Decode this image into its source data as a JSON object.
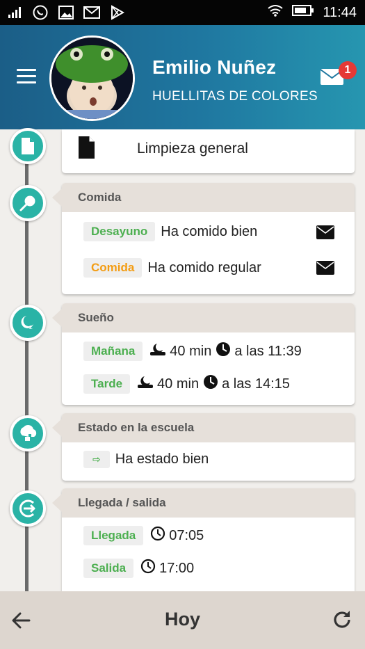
{
  "status_bar": {
    "time": "11:44"
  },
  "header": {
    "user_name": "Emilio Nuñez",
    "school": "HUELLITAS DE COLORES",
    "unread_count": "1"
  },
  "timeline": {
    "limpieza": {
      "label": "Limpieza general"
    },
    "comida": {
      "title": "Comida",
      "items": [
        {
          "tag": "Desayuno",
          "text": "Ha comido bien"
        },
        {
          "tag": "Comida",
          "text": "Ha comido regular"
        }
      ]
    },
    "sueno": {
      "title": "Sueño",
      "items": [
        {
          "tag": "Mañana",
          "duration": "40 min",
          "time_text": "a las 11:39"
        },
        {
          "tag": "Tarde",
          "duration": "40 min",
          "time_text": "a las 14:15"
        }
      ]
    },
    "estado": {
      "title": "Estado en la escuela",
      "arrow": "⇨",
      "text": "Ha estado bien"
    },
    "llegada": {
      "title": "Llegada / salida",
      "items": [
        {
          "tag": "Llegada",
          "time": "07:05"
        },
        {
          "tag": "Salida",
          "time": "17:00"
        }
      ]
    }
  },
  "bottom_bar": {
    "title": "Hoy"
  },
  "colors": {
    "accent": "#2ab3a6",
    "header_start": "#1b5e87",
    "header_end": "#2696b0",
    "green_tag": "#4caf50",
    "orange_tag": "#f39c12",
    "badge": "#e53935"
  }
}
